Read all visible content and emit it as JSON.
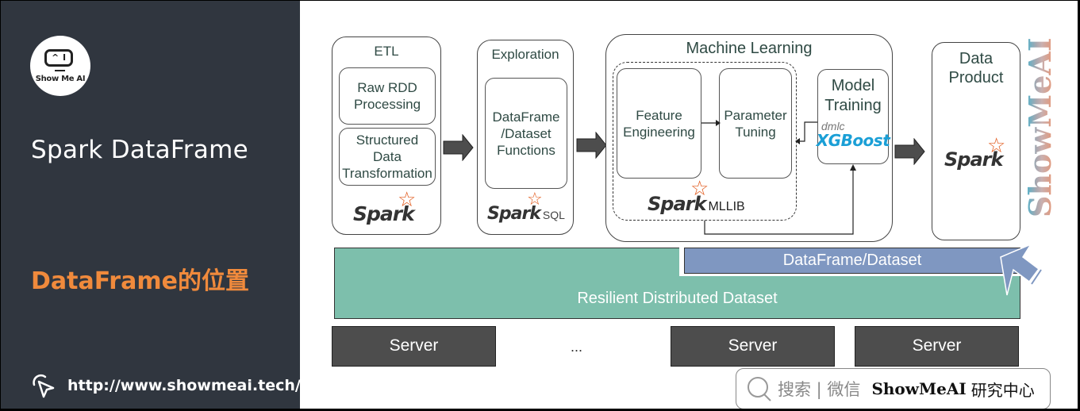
{
  "sidebar": {
    "logo_text": "Show Me AI",
    "logo_screen_text": "^ I",
    "title": "Spark DataFrame",
    "subtitle": "DataFrame的位置",
    "url": "http://www.showmeai.tech/",
    "accent_color": "#f08a3c",
    "background_color": "#30363f"
  },
  "diagram": {
    "etl": {
      "header": "ETL",
      "items": [
        "Raw RDD Processing",
        "Structured Data Transformation"
      ],
      "logo": "Spark"
    },
    "exploration": {
      "header": "Exploration",
      "items": [
        "DataFrame /Dataset Functions"
      ],
      "logo": "Spark",
      "logo_suffix": "SQL"
    },
    "machine_learning": {
      "header": "Machine Learning",
      "items": [
        "Feature Engineering",
        "Parameter Tuning"
      ],
      "logo": "Spark",
      "logo_suffix": "MLLIB",
      "model_training": {
        "label": "Model Training",
        "lib_prefix": "dmlc",
        "lib_name": "XGBoost",
        "lib_color": "#1a9fd6"
      }
    },
    "data_product": {
      "header": "Data Product",
      "logo": "Spark"
    },
    "layers": {
      "dataframe": "DataFrame/Dataset",
      "rdd": "Resilient Distributed Dataset",
      "rdd_color": "#7dbfac",
      "dataframe_color": "#7f97c1"
    },
    "servers": [
      "Server",
      "Server",
      "Server"
    ],
    "ellipsis": "..."
  },
  "watermark": "ShowMeAI",
  "search_bar": {
    "prompt": "搜索 | 微信",
    "brand": "ShowMeAI",
    "suffix": "研究中心"
  }
}
